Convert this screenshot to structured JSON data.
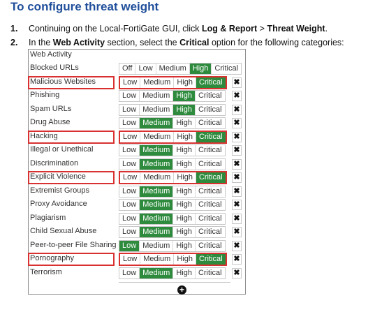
{
  "heading": "To configure threat weight",
  "steps": [
    {
      "num": "1.",
      "pre": "Continuing on the Local-FortiGate GUI, click ",
      "b1": "Log & Report",
      "mid": " > ",
      "b2": "Threat Weight",
      "post": "."
    },
    {
      "num": "2.",
      "pre": "In the ",
      "b1": "Web Activity",
      "mid": " section, select the ",
      "b2": "Critical",
      "post": " option for the following categories:"
    }
  ],
  "panel": {
    "title": "Web Activity",
    "header_row": {
      "label": "Blocked URLs",
      "options": [
        "Off",
        "Low",
        "Medium",
        "High",
        "Critical"
      ],
      "selected": "High"
    },
    "rows": [
      {
        "label": "Malicious Websites",
        "selected": "Critical",
        "highlighted": true
      },
      {
        "label": "Phishing",
        "selected": "High",
        "highlighted": false
      },
      {
        "label": "Spam URLs",
        "selected": "High",
        "highlighted": false
      },
      {
        "label": "Drug Abuse",
        "selected": "Medium",
        "highlighted": false
      },
      {
        "label": "Hacking",
        "selected": "Critical",
        "highlighted": true
      },
      {
        "label": "Illegal or Unethical",
        "selected": "Medium",
        "highlighted": false
      },
      {
        "label": "Discrimination",
        "selected": "Medium",
        "highlighted": false
      },
      {
        "label": "Explicit Violence",
        "selected": "Critical",
        "highlighted": true
      },
      {
        "label": "Extremist Groups",
        "selected": "Medium",
        "highlighted": false
      },
      {
        "label": "Proxy Avoidance",
        "selected": "Medium",
        "highlighted": false
      },
      {
        "label": "Plagiarism",
        "selected": "Medium",
        "highlighted": false
      },
      {
        "label": "Child Sexual Abuse",
        "selected": "Medium",
        "highlighted": false
      },
      {
        "label": "Peer-to-peer File Sharing",
        "selected": "Low",
        "highlighted": false
      },
      {
        "label": "Pornography",
        "selected": "Critical",
        "highlighted": true
      },
      {
        "label": "Terrorism",
        "selected": "Medium",
        "highlighted": false
      }
    ],
    "row_options": [
      "Low",
      "Medium",
      "High",
      "Critical"
    ],
    "remove_symbol": "✖",
    "add_symbol": "+"
  },
  "colors": {
    "heading": "#1f4e9a",
    "selected": "#2e8b3d",
    "highlight": "#d93030"
  }
}
